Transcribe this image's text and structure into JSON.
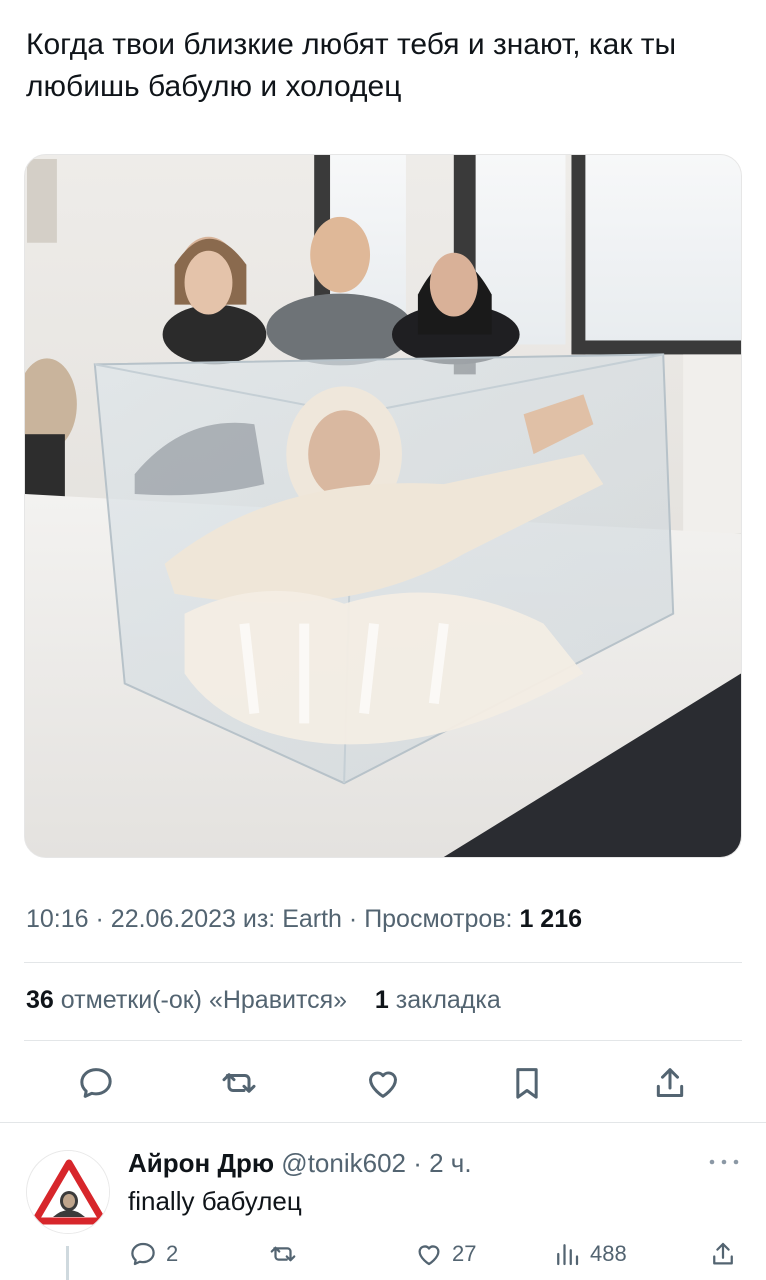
{
  "tweet": {
    "text": "Когда твои близкие любят тебя и знают, как ты любишь бабулю и холодец",
    "meta": {
      "time": "10:16",
      "date": "22.06.2023",
      "source": "из: Earth",
      "views_label": "Просмотров:",
      "views_count": "1 216"
    },
    "stats": {
      "likes_count": "36",
      "likes_label": "отметки(-ок) «Нравится»",
      "bookmarks_count": "1",
      "bookmarks_label": "закладка"
    },
    "actions": [
      "reply-icon",
      "retweet-icon",
      "heart-icon",
      "bookmark-icon",
      "share-icon"
    ]
  },
  "reply": {
    "name": "Айрон Дрю",
    "handle": "@tonik602",
    "time": "· 2 ч.",
    "text": "finally бабулец",
    "counts": {
      "replies": "2",
      "retweets": "",
      "likes": "27",
      "views": "488"
    }
  },
  "colors": {
    "text_primary": "#0f1419",
    "text_secondary": "#536471",
    "divider": "#e3e6e8"
  }
}
